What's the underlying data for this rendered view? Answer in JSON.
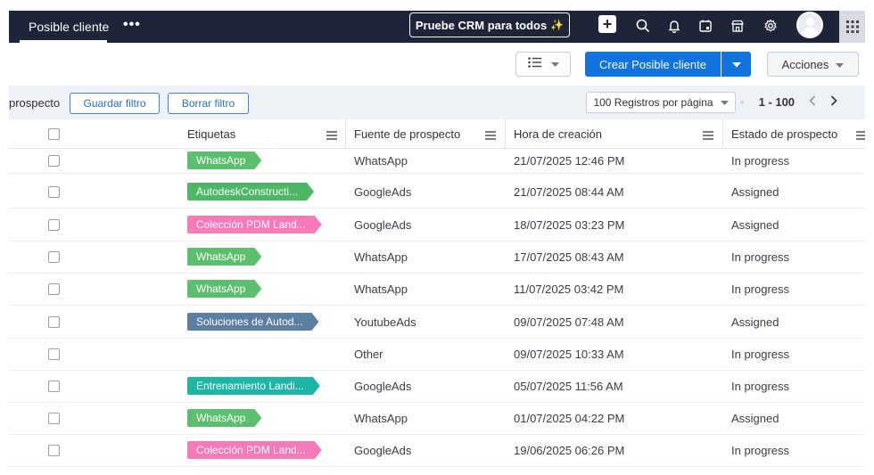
{
  "topbar": {
    "active_tab": "Posible cliente",
    "more": "•••",
    "trial_button": "Pruebe CRM para todos",
    "trial_sparkle": "✨",
    "icons": [
      "plus-icon",
      "search-icon",
      "bell-icon",
      "calendar-icon",
      "store-icon",
      "gear-icon",
      "avatar",
      "apps-grid-icon"
    ]
  },
  "toolbar": {
    "create_button": "Crear Posible cliente",
    "actions_button": "Acciones"
  },
  "filterbar": {
    "label": "prospecto",
    "save_filter": "Guardar filtro",
    "clear_filter": "Borrar filtro",
    "per_page": "100 Registros por página",
    "range": "1 - 100"
  },
  "table": {
    "headers": {
      "tags": "Etiquetas",
      "source": "Fuente de prospecto",
      "created": "Hora de creación",
      "status": "Estado de prospecto"
    },
    "rows": [
      {
        "tag": "WhatsApp",
        "tag_color": "#5cbf6e",
        "source": "WhatsApp",
        "created": "21/07/2025 12:46 PM",
        "status": "In progress"
      },
      {
        "tag": "AutodeskConstructi...",
        "tag_color": "#4cb866",
        "source": "GoogleAds",
        "created": "21/07/2025 08:44 AM",
        "status": "Assigned"
      },
      {
        "tag": "Colección PDM Land...",
        "tag_color": "#f57bb8",
        "source": "GoogleAds",
        "created": "18/07/2025 03:23 PM",
        "status": "Assigned"
      },
      {
        "tag": "WhatsApp",
        "tag_color": "#5cbf6e",
        "source": "WhatsApp",
        "created": "17/07/2025 08:43 AM",
        "status": "In progress"
      },
      {
        "tag": "WhatsApp",
        "tag_color": "#5cbf6e",
        "source": "WhatsApp",
        "created": "11/07/2025 03:42 PM",
        "status": "In progress"
      },
      {
        "tag": "Soluciones de Autod...",
        "tag_color": "#5b7fa0",
        "source": "YoutubeAds",
        "created": "09/07/2025 07:48 AM",
        "status": "Assigned"
      },
      {
        "tag": "",
        "tag_color": "",
        "source": "Other",
        "created": "09/07/2025 10:33 AM",
        "status": "In progress"
      },
      {
        "tag": "Entrenamiento Landi...",
        "tag_color": "#1fb5a4",
        "source": "GoogleAds",
        "created": "05/07/2025 11:56 AM",
        "status": "In progress"
      },
      {
        "tag": "WhatsApp",
        "tag_color": "#5cbf6e",
        "source": "WhatsApp",
        "created": "01/07/2025 04:22 PM",
        "status": "Assigned"
      },
      {
        "tag": "Colección PDM Land...",
        "tag_color": "#f57bb8",
        "source": "GoogleAds",
        "created": "19/06/2025 06:26 PM",
        "status": "In progress"
      }
    ]
  },
  "colors": {
    "topbar_bg": "#1f2538",
    "primary_button": "#1173de",
    "filterbar_bg": "#eef1f5"
  }
}
